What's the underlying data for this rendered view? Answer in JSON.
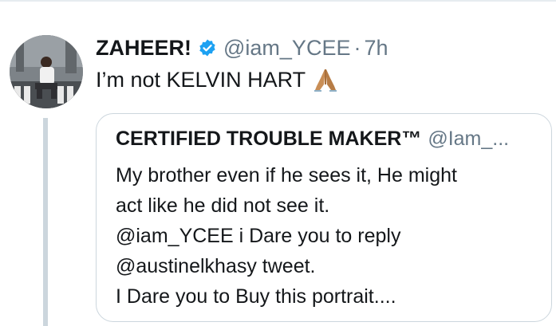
{
  "tweet": {
    "display_name": "ZAHEER!",
    "handle": "@iam_YCEE",
    "separator": "·",
    "time": "7h",
    "text": "I’m not KELVIN HART",
    "emoji": "folded-hands-icon"
  },
  "quoted_tweet": {
    "display_name": "CERTIFIED TROUBLE MAKER™",
    "handle": "@Iam_...",
    "lines": [
      "My brother even if he sees it, He might",
      "act like he did not see it.",
      "@iam_YCEE i Dare you to reply",
      "@austinelkhasy  tweet.",
      "I Dare you to Buy this portrait...."
    ]
  },
  "colors": {
    "text_primary": "#14171a",
    "text_secondary": "#657786",
    "verified_blue": "#1da1f2",
    "border": "#ccd6dd"
  }
}
